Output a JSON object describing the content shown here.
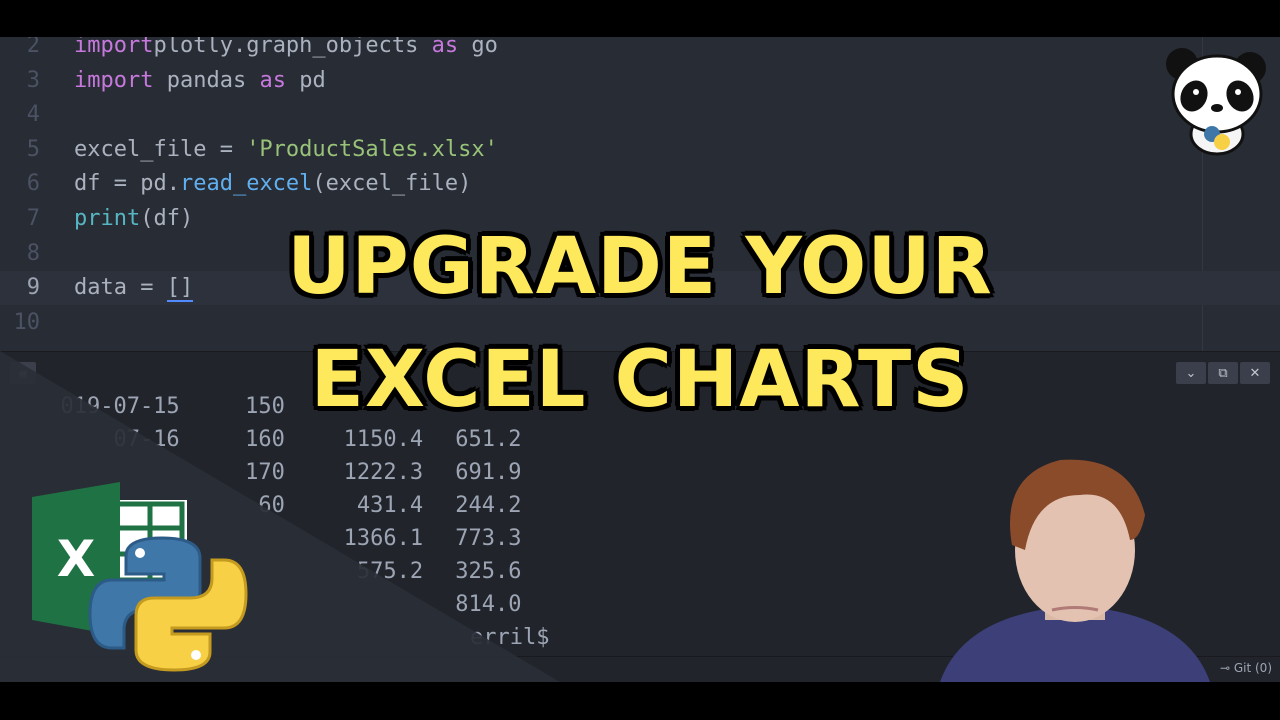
{
  "editor": {
    "lines": [
      {
        "num": "2",
        "parts": [
          [
            "kw",
            "import"
          ],
          [
            "",
            "plotly.graph_objects "
          ],
          [
            "kw",
            "as"
          ],
          [
            "",
            " go"
          ]
        ]
      },
      {
        "num": "3",
        "parts": [
          [
            "kw",
            "import"
          ],
          [
            "",
            " pandas "
          ],
          [
            "kw",
            "as"
          ],
          [
            "",
            " pd"
          ]
        ]
      },
      {
        "num": "4",
        "parts": []
      },
      {
        "num": "5",
        "parts": [
          [
            "",
            "excel_file = "
          ],
          [
            "str",
            "'ProductSales.xlsx'"
          ]
        ]
      },
      {
        "num": "6",
        "parts": [
          [
            "",
            "df = pd."
          ],
          [
            "fn",
            "read_excel"
          ],
          [
            "",
            "(excel_file)"
          ]
        ]
      },
      {
        "num": "7",
        "parts": [
          [
            "bi",
            "print"
          ],
          [
            "",
            "(df)"
          ]
        ]
      },
      {
        "num": "8",
        "parts": []
      },
      {
        "num": "9",
        "parts": [
          [
            "",
            "data = "
          ],
          [
            "bracket",
            "[]"
          ]
        ],
        "current": true
      },
      {
        "num": "10",
        "parts": []
      }
    ]
  },
  "terminal": {
    "rows": [
      {
        "date": "019-07-15",
        "qty": "150",
        "v1": "",
        "v2": ""
      },
      {
        "date": "07-16",
        "qty": "160",
        "v1": "1150.4",
        "v2": "651.2"
      },
      {
        "date": "",
        "qty": "170",
        "v1": "1222.3",
        "v2": "691.9"
      },
      {
        "date": "",
        "qty": "60",
        "v1": "431.4",
        "v2": "244.2"
      },
      {
        "date": "",
        "qty": "",
        "v1": "1366.1",
        "v2": "773.3"
      },
      {
        "date": "",
        "qty": "",
        "v1": "575.2",
        "v2": "325.6"
      },
      {
        "date": "",
        "qty": "",
        "v1": "",
        "v2": "814.0"
      }
    ],
    "prompt": "erril$",
    "toolbar": {
      "collapse": "⌄",
      "maximize": "⧉",
      "close": "✕"
    }
  },
  "status_bar": {
    "git_label": "Git (0)"
  },
  "thumbnail": {
    "title_line1": "UPGRADE YOUR",
    "title_line2": "EXCEL CHARTS",
    "excel_letter": "X",
    "colors": {
      "title": "#fde95b",
      "excel_green": "#1f7244",
      "python_blue": "#3f77a8",
      "python_yellow": "#f7d046"
    }
  }
}
